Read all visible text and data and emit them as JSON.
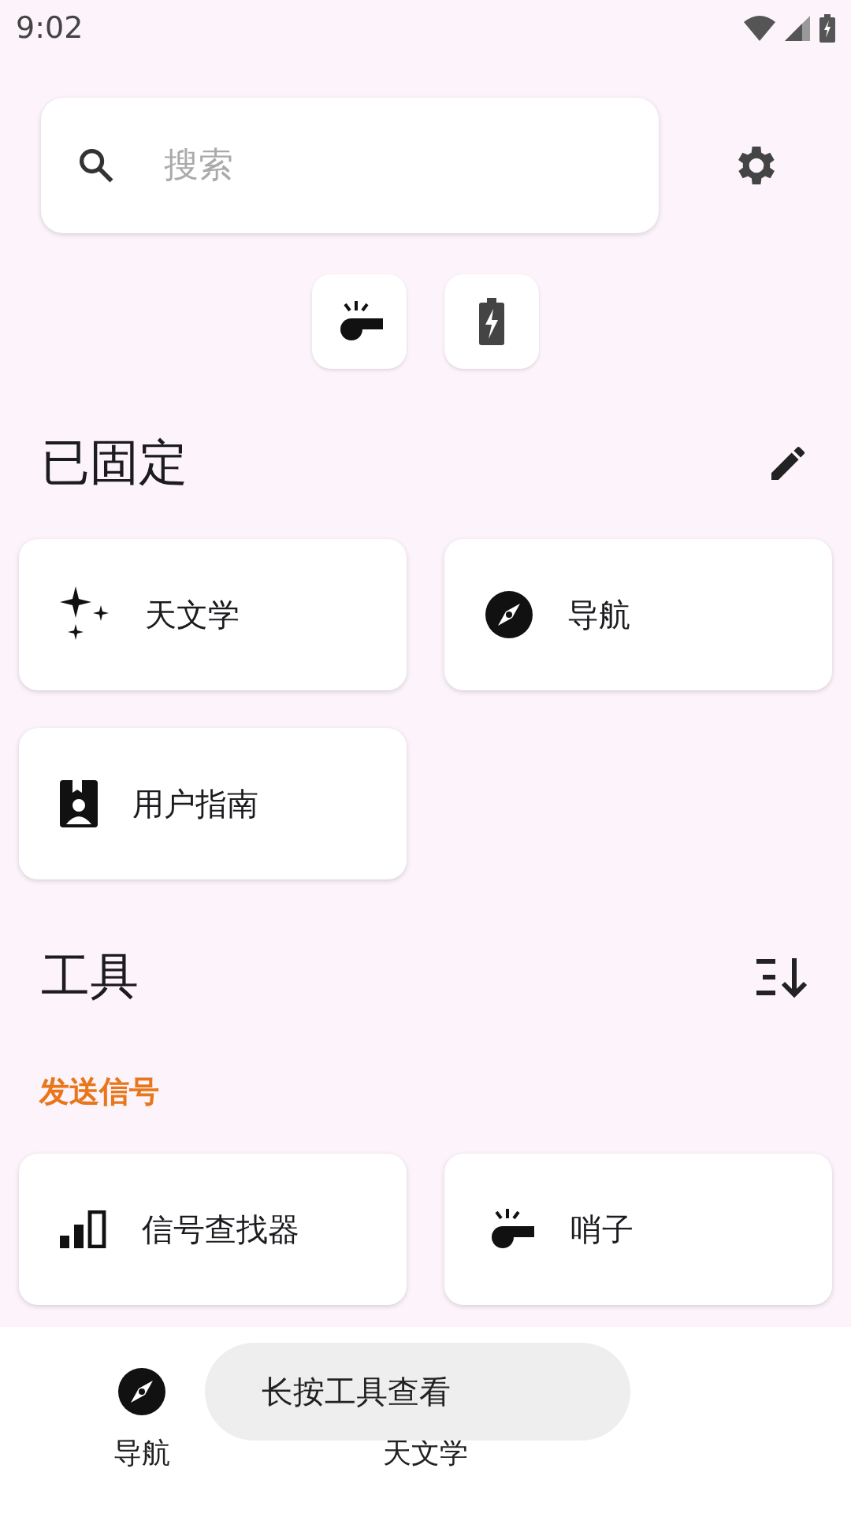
{
  "status_bar": {
    "time": "9:02"
  },
  "search": {
    "placeholder": "搜索"
  },
  "quick_actions": [
    {
      "kind": "whistle"
    },
    {
      "kind": "battery"
    }
  ],
  "pinned": {
    "title": "已固定",
    "items": [
      {
        "label": "天文学",
        "kind": "sparkle"
      },
      {
        "label": "导航",
        "kind": "compass"
      },
      {
        "label": "用户指南",
        "kind": "guide"
      }
    ]
  },
  "tools": {
    "title": "工具",
    "sections": [
      {
        "title": "发送信号",
        "items": [
          {
            "label": "信号查找器",
            "kind": "signal"
          },
          {
            "label": "哨子",
            "kind": "whistle"
          }
        ]
      }
    ]
  },
  "bottom_nav": [
    {
      "label": "导航",
      "kind": "compass"
    },
    {
      "label": "天文学"
    }
  ],
  "toast": "长按工具查看"
}
